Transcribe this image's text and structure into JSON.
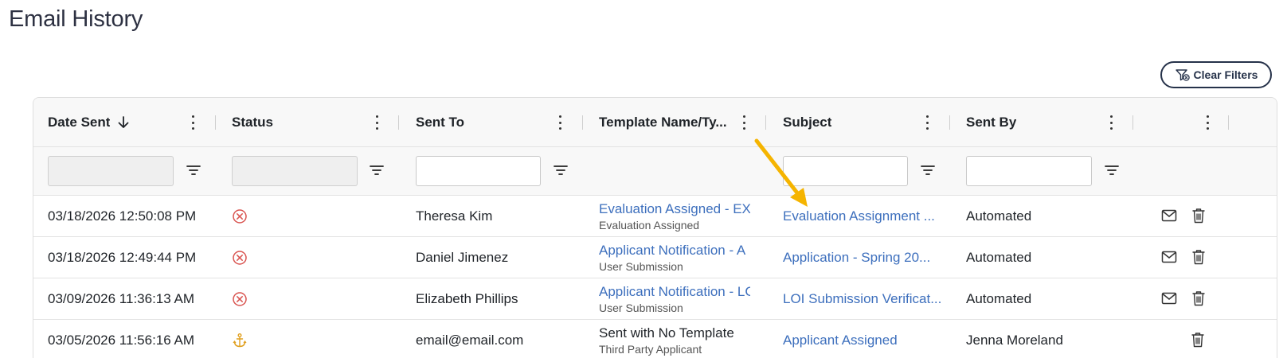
{
  "page": {
    "title": "Email History"
  },
  "toolbar": {
    "clear_filters_label": "Clear Filters"
  },
  "grid": {
    "columns": [
      {
        "label": "Date Sent",
        "sorted": "descending"
      },
      {
        "label": "Status"
      },
      {
        "label": "Sent To"
      },
      {
        "label": "Template Name/Ty..."
      },
      {
        "label": "Subject"
      },
      {
        "label": "Sent By"
      },
      {
        "label": ""
      }
    ],
    "filters": {
      "date_sent": "",
      "status": "",
      "sent_to": "",
      "subject": "",
      "sent_by": ""
    },
    "rows": [
      {
        "date_sent": "03/18/2026 12:50:08 PM",
        "status_icon": "error-circle-icon",
        "sent_to": "Theresa Kim",
        "template_name": "Evaluation Assigned - EXA",
        "template_type": "Evaluation Assigned",
        "subject": "Evaluation Assignment ...",
        "sent_by": "Automated",
        "has_resend": true
      },
      {
        "date_sent": "03/18/2026 12:49:44 PM",
        "status_icon": "error-circle-icon",
        "sent_to": "Daniel Jimenez",
        "template_name": "Applicant Notification - A",
        "template_type": "User Submission",
        "subject": "Application - Spring 20...",
        "sent_by": "Automated",
        "has_resend": true
      },
      {
        "date_sent": "03/09/2026 11:36:13 AM",
        "status_icon": "error-circle-icon",
        "sent_to": "Elizabeth Phillips",
        "template_name": "Applicant Notification - LC",
        "template_type": "User Submission",
        "subject": "LOI Submission Verificat...",
        "sent_by": "Automated",
        "has_resend": true
      },
      {
        "date_sent": "03/05/2026 11:56:16 AM",
        "status_icon": "anchor-icon",
        "sent_to": "email@email.com",
        "template_name": "Sent with No Template",
        "template_type": "Third Party Applicant",
        "subject": "Applicant Assigned",
        "sent_by": "Jenna Moreland",
        "has_resend": false
      }
    ]
  },
  "colors": {
    "link": "#3d6fbd",
    "error_status": "#d9534f",
    "anchor_status": "#e0a020",
    "arrow_annotation": "#f5b400",
    "button_border": "#26324a"
  }
}
